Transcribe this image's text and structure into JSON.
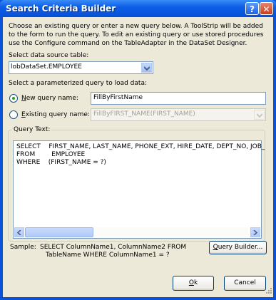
{
  "window": {
    "title": "Search Criteria Builder",
    "help_glyph": "?",
    "close_glyph": "✕"
  },
  "description": "Choose an existing query or enter a new query below. A ToolStrip will be added to the form to run the query. To edit an existing query or use stored procedures use the Configure command on the TableAdapter in the DataSet Designer.",
  "data_source": {
    "label": "Select data source table:",
    "value": "lobDataSet.EMPLOYEE"
  },
  "query_section": {
    "label": "Select a parameterized query to load data:",
    "new_query": {
      "label_prefix": "N",
      "label_rest": "ew query name:",
      "value": "FillByFirstName",
      "selected": true
    },
    "existing_query": {
      "label_prefix": "E",
      "label_rest": "xisting query name:",
      "value": "FillByFIRST_NAME(FIRST_NAME)",
      "selected": false
    }
  },
  "query_text": {
    "label": "Query Text:",
    "lines": [
      "SELECT    FIRST_NAME, LAST_NAME, PHONE_EXT, HIRE_DATE, DEPT_NO, JOB_",
      "FROM        EMPLOYEE",
      "WHERE    (FIRST_NAME = ?)"
    ]
  },
  "sample": {
    "label": "Sample:",
    "line1": "SELECT ColumnName1, ColumnName2 FROM",
    "line2": "TableName WHERE ColumnName1 = ?"
  },
  "buttons": {
    "query_builder": {
      "prefix": "Q",
      "rest": "uery Builder..."
    },
    "ok": {
      "prefix": "O",
      "rest": "k"
    },
    "cancel": "Cancel"
  },
  "icons": {
    "help": "help-icon",
    "close": "close-icon",
    "dropdown": "chevron-down-icon",
    "scroll_left": "arrow-left-icon",
    "scroll_right": "arrow-right-icon",
    "resize_grip": "resize-grip-icon"
  },
  "colors": {
    "title_bar": "#0650d9",
    "dialog_bg": "#ece9d8",
    "border": "#7f9db9"
  }
}
